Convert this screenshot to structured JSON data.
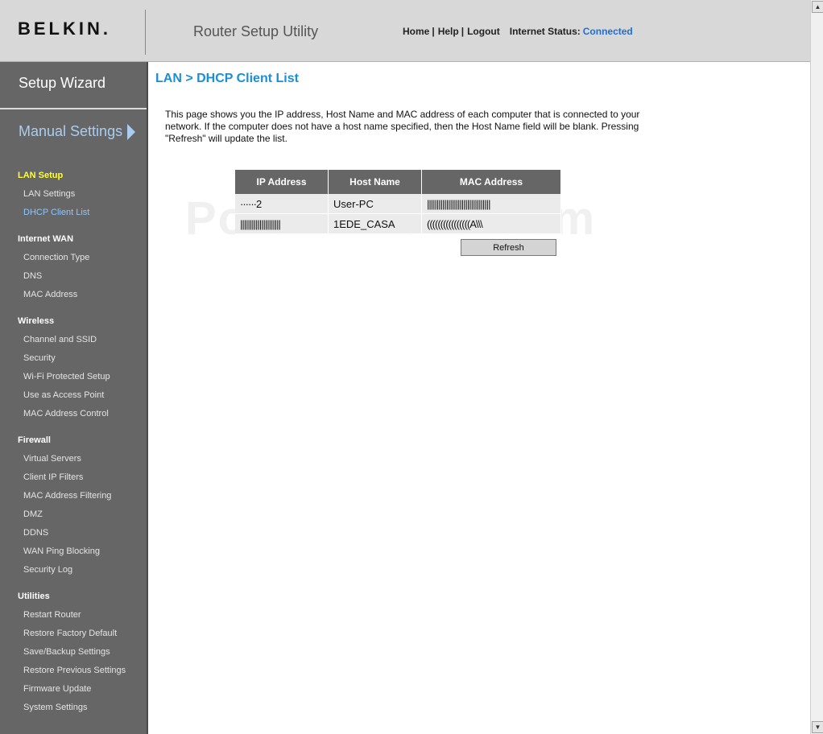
{
  "header": {
    "logo": "BELKIN.",
    "utility_title": "Router Setup Utility",
    "nav": {
      "home": "Home",
      "help": "Help",
      "logout": "Logout",
      "sep": "|"
    },
    "status_label": "Internet Status:",
    "status_value": "Connected"
  },
  "sidebar": {
    "wizard": "Setup Wizard",
    "manual": "Manual Settings",
    "sections": [
      {
        "title": "LAN Setup",
        "items": [
          "LAN Settings",
          "DHCP Client List"
        ]
      },
      {
        "title": "Internet WAN",
        "items": [
          "Connection Type",
          "DNS",
          "MAC Address"
        ]
      },
      {
        "title": "Wireless",
        "items": [
          "Channel and SSID",
          "Security",
          "Wi-Fi Protected Setup",
          "Use as Access Point",
          "MAC Address Control"
        ]
      },
      {
        "title": "Firewall",
        "items": [
          "Virtual Servers",
          "Client IP Filters",
          "MAC Address Filtering",
          "DMZ",
          "DDNS",
          "WAN Ping Blocking",
          "Security Log"
        ]
      },
      {
        "title": "Utilities",
        "items": [
          "Restart Router",
          "Restore Factory Default",
          "Save/Backup Settings",
          "Restore Previous Settings",
          "Firmware Update",
          "System Settings"
        ]
      }
    ]
  },
  "main": {
    "title": "LAN > DHCP Client List",
    "description": "This page shows you the IP address, Host Name and MAC address of each computer that is connected to your network. If the computer does not have a host name specified, then the Host Name field will be blank. Pressing \"Refresh\" will update the list.",
    "watermark": "PortForward.com",
    "table": {
      "headers": [
        "IP Address",
        "Host Name",
        "MAC Address"
      ],
      "rows": [
        [
          "······2",
          "User-PC",
          "|||||||||||||||||||||||||||||||||"
        ],
        [
          "|||||||||||||||||||||",
          "1EDE_CASA",
          "((((((((((((((((A\\\\\\"
        ]
      ]
    },
    "refresh_label": "Refresh"
  },
  "colors": {
    "accent": "#1a8fd8",
    "sidebar_bg": "#666666",
    "header_bg": "#d8d8d8",
    "active_section": "#ffff33",
    "current_item": "#8cc6ff"
  }
}
